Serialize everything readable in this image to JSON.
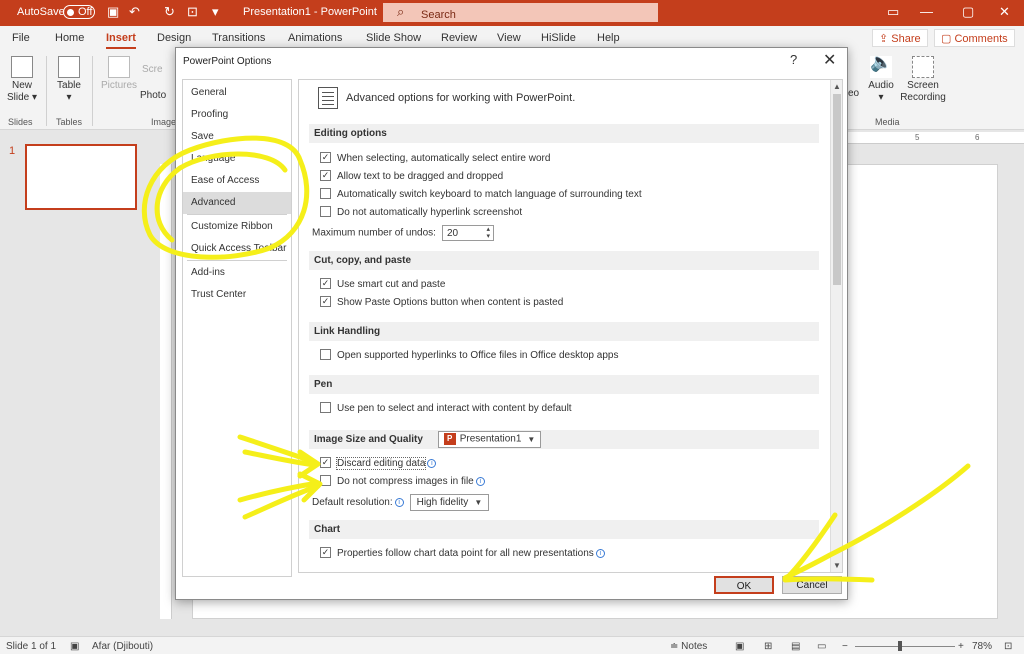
{
  "titlebar": {
    "autosave_label": "AutoSave",
    "autosave_state": "Off",
    "doc_title": "Presentation1  -  PowerPoint",
    "search_placeholder": "Search"
  },
  "tabs": [
    "File",
    "Home",
    "Insert",
    "Design",
    "Transitions",
    "Animations",
    "Slide Show",
    "Review",
    "View",
    "HiSlide",
    "Help"
  ],
  "active_tab": "Insert",
  "share_label": "Share",
  "comments_label": "Comments",
  "ribbon": {
    "new_slide": "New Slide",
    "table": "Table",
    "pictures": "Pictures",
    "screenshot_partial": "Scre",
    "photo_partial": "Photo",
    "video_partial": "eo",
    "audio": "Audio",
    "screen_recording": "Screen Recording",
    "groups": {
      "slides": "Slides",
      "tables": "Tables",
      "images_partial": "Image",
      "media": "Media"
    }
  },
  "ruler_marks": [
    "5",
    "6"
  ],
  "slide_number": "1",
  "statusbar": {
    "slide_info": "Slide 1 of 1",
    "language": "Afar (Djibouti)",
    "notes": "Notes",
    "zoom": "78%"
  },
  "dialog": {
    "title": "PowerPoint Options",
    "help": "?",
    "close": "✕",
    "nav": [
      "General",
      "Proofing",
      "Save",
      "Language",
      "Ease of Access",
      "Advanced",
      "Customize Ribbon",
      "Quick Access Toolbar",
      "Add-ins",
      "Trust Center"
    ],
    "nav_selected": "Advanced",
    "header": "Advanced options for working with PowerPoint.",
    "sections": {
      "editing": {
        "title": "Editing options",
        "opt1": "When selecting, automatically select entire word",
        "opt2": "Allow text to be dragged and dropped",
        "opt3": "Automatically switch keyboard to match language of surrounding text",
        "opt4": "Do not automatically hyperlink screenshot",
        "undos_label": "Maximum number of undos:",
        "undos_value": "20"
      },
      "cutcopy": {
        "title": "Cut, copy, and paste",
        "opt1": "Use smart cut and paste",
        "opt2": "Show Paste Options button when content is pasted"
      },
      "links": {
        "title": "Link Handling",
        "opt1": "Open supported hyperlinks to Office files in Office desktop apps"
      },
      "pen": {
        "title": "Pen",
        "opt1": "Use pen to select and interact with content by default"
      },
      "image": {
        "title": "Image Size and Quality",
        "file_dropdown": "Presentation1",
        "opt1": "Discard editing data",
        "opt2": "Do not compress images in file",
        "resolution_label": "Default resolution:",
        "resolution_value": "High fidelity"
      },
      "chart": {
        "title": "Chart",
        "opt1": "Properties follow chart data point for all new presentations"
      }
    },
    "ok_label": "OK",
    "cancel_label": "Cancel"
  },
  "checkbox_state": {
    "edit1": true,
    "edit2": true,
    "edit3": false,
    "edit4": false,
    "cut1": true,
    "cut2": true,
    "link1": false,
    "pen1": false,
    "img1": true,
    "img2": false,
    "chart1": true
  },
  "colors": {
    "accent": "#c43e1c",
    "annotation": "#f5ef1a"
  }
}
